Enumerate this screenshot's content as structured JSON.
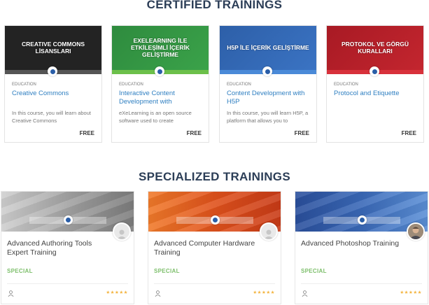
{
  "certified": {
    "title": "CERTIFIED TRAININGS",
    "cards": [
      {
        "banner_text": "CREATIVE COMMONS LİSANSLARI",
        "category": "EDUCATION",
        "title": "Creative Commons",
        "description": "In this course, you will learn about Creative Commons",
        "price": "FREE",
        "banner_color": "#232323",
        "stripe_color": "#555555"
      },
      {
        "banner_text": "EXELEARNING İLE ETKİLEŞİMLİ İÇERİK GELİŞTİRME",
        "category": "EDUCATION",
        "title": "Interactive Content Development with",
        "description": "eXeLearning is an open source software used to create",
        "price": "FREE",
        "banner_color": "#2e8b3e",
        "stripe_color": "#6cc04a"
      },
      {
        "banner_text": "H5P İLE İÇERİK GELİŞTİRME",
        "category": "EDUCATION",
        "title": "Content Development with H5P",
        "description": "In this course, you will learn H5P, a platform that allows you to",
        "price": "FREE",
        "banner_color": "#2d5fa8",
        "stripe_color": "#4a8ad8"
      },
      {
        "banner_text": "PROTOKOL VE GÖRGÜ KURALLARI",
        "category": "EDUCATION",
        "title": "Protocol and Etiquette",
        "description": "",
        "price": "FREE",
        "banner_color": "#b31e28",
        "stripe_color": "#d8313b"
      }
    ]
  },
  "specialized": {
    "title": "SPECIALIZED TRAININGS",
    "cards": [
      {
        "title": "Advanced Authoring Tools Expert Training",
        "badge": "SPECIAL",
        "stars": "★★★★★",
        "banner_color": "#a9a9a9",
        "avatar": "placeholder"
      },
      {
        "title": "Advanced Computer Hardware Training",
        "badge": "SPECIAL",
        "stars": "★★★★★",
        "banner_color": "#e35a1f",
        "avatar": "placeholder"
      },
      {
        "title": "Advanced Photoshop Training",
        "badge": "SPECIAL",
        "stars": "★★★★★",
        "banner_color": "#3a69b8",
        "avatar": "photo"
      }
    ]
  },
  "icons": {
    "logo": "exe-logo-icon",
    "user": "user-icon",
    "avatar": "avatar-icon",
    "star": "star-icon"
  }
}
